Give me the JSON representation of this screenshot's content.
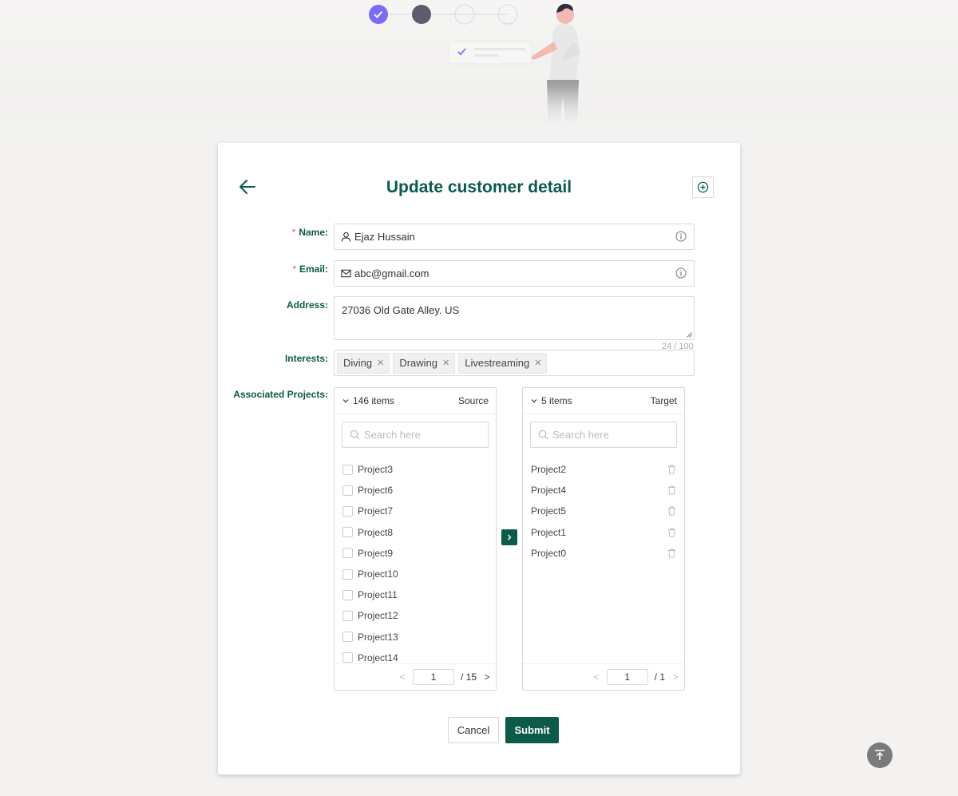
{
  "form": {
    "title": "Update customer detail",
    "name_label": "Name",
    "name_value": "Ejaz Hussain",
    "email_label": "Email",
    "email_value": "abc@gmail.com",
    "address_label": "Address",
    "address_value": "27036 Old Gate Alley. US",
    "address_counter": "24 / 100",
    "interests_label": "Interests",
    "interests": [
      "Diving",
      "Drawing",
      "Livestreaming"
    ],
    "projects_label": "Associated Projects",
    "colon": ":"
  },
  "source": {
    "count": "146 items",
    "title": "Source",
    "search_placeholder": "Search here",
    "items": [
      "Project3",
      "Project6",
      "Project7",
      "Project8",
      "Project9",
      "Project10",
      "Project11",
      "Project12",
      "Project13",
      "Project14"
    ],
    "page": "1",
    "page_total": "/ 15"
  },
  "target": {
    "count": "5 items",
    "title": "Target",
    "search_placeholder": "Search here",
    "items": [
      "Project2",
      "Project4",
      "Project5",
      "Project1",
      "Project0"
    ],
    "page": "1",
    "page_total": "/ 1"
  },
  "buttons": {
    "cancel": "Cancel",
    "submit": "Submit"
  },
  "colors": {
    "primary": "#0b5a4a",
    "required": "#ff4d4f",
    "step_done": "#7b6cf6",
    "step_current": "#5c5c6e"
  },
  "icons": {
    "back": "arrow-left-icon",
    "add": "plus-circle-icon",
    "user": "user-icon",
    "mail": "mail-icon",
    "info": "info-circle-icon",
    "search": "search-icon",
    "trash": "trash-icon",
    "transfer": "chevron-right-icon",
    "back_to_top": "vertical-align-top-icon"
  }
}
